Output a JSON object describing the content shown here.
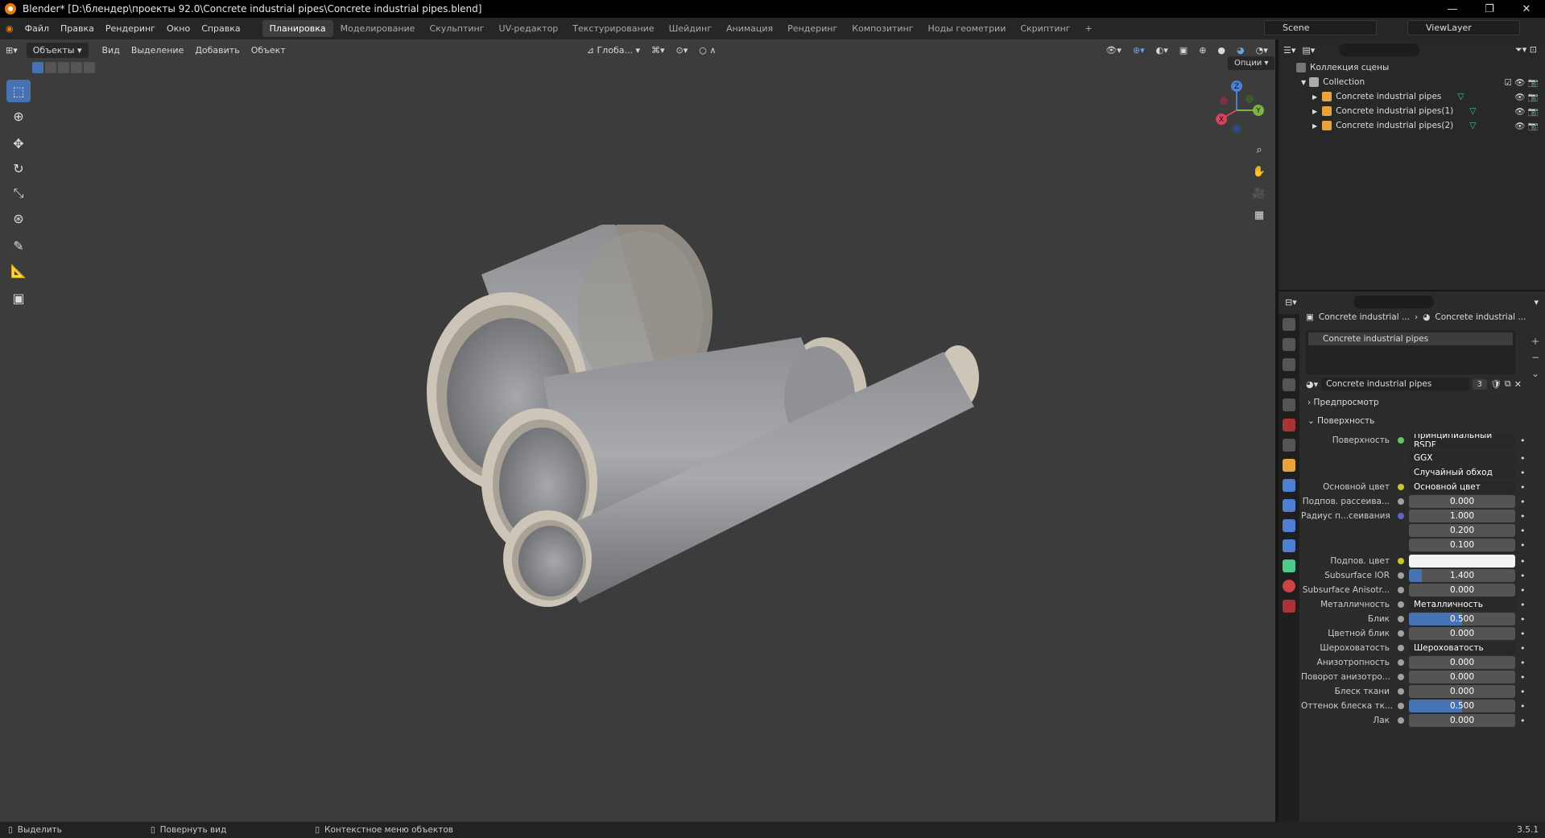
{
  "window": {
    "title": "Blender* [D:\\блендер\\проекты 92.0\\Concrete industrial pipes\\Concrete industrial pipes.blend]",
    "minimize": "—",
    "maximize": "❐",
    "close": "✕"
  },
  "menu": [
    "Файл",
    "Правка",
    "Рендеринг",
    "Окно",
    "Справка"
  ],
  "workspaces": [
    "Планировка",
    "Моделирование",
    "Скульптинг",
    "UV-редактор",
    "Текстурирование",
    "Шейдинг",
    "Анимация",
    "Рендеринг",
    "Композитинг",
    "Ноды геометрии",
    "Скриптинг"
  ],
  "workspace_add": "+",
  "scene": "Scene",
  "view_layer": "ViewLayer",
  "viewport_header": {
    "mode": "Объекты",
    "menus": [
      "Вид",
      "Выделение",
      "Добавить",
      "Объект"
    ],
    "orientation": "Глоба...",
    "options": "Опции"
  },
  "gizmo": {
    "x": "X",
    "y": "Y",
    "z": "Z"
  },
  "outliner": {
    "scene_collection": "Коллекция сцены",
    "collection": "Collection",
    "objects": [
      "Concrete industrial pipes",
      "Concrete industrial pipes(1)",
      "Concrete industrial pipes(2)"
    ]
  },
  "properties": {
    "breadcrumb_object": "Concrete industrial ...",
    "breadcrumb_material": "Concrete industrial ...",
    "slot": "Concrete industrial pipes",
    "material_name": "Concrete industrial pipes",
    "users": "3",
    "sections": {
      "preview": "Предпросмотр",
      "surface": "Поверхность"
    },
    "rows": [
      {
        "label": "Поверхность",
        "value": "Принципиальный BSDF",
        "type": "link",
        "dot": "#63c763"
      },
      {
        "label": "",
        "value": "GGX",
        "type": "enum"
      },
      {
        "label": "",
        "value": "Случайный обход",
        "type": "enum"
      },
      {
        "label": "Основной цвет",
        "value": "Основной цвет",
        "type": "link",
        "dot": "#c7c729"
      },
      {
        "label": "Подпов. рассеива...",
        "value": "0.000",
        "type": "num",
        "dot": "#a1a1a1",
        "fill": 0
      },
      {
        "label": "Радиус п...сеивания",
        "value": "1.000",
        "type": "num",
        "dot": "#6363c7",
        "fill": 0
      },
      {
        "label": "",
        "value": "0.200",
        "type": "num",
        "fill": 0
      },
      {
        "label": "",
        "value": "0.100",
        "type": "num",
        "fill": 0
      },
      {
        "label": "Подпов. цвет",
        "value": "",
        "type": "color",
        "dot": "#c7c729",
        "color": "#f2f2f2"
      },
      {
        "label": "Subsurface IOR",
        "value": "1.400",
        "type": "num",
        "dot": "#a1a1a1",
        "fill": 0.12
      },
      {
        "label": "Subsurface Anisotr...",
        "value": "0.000",
        "type": "num",
        "dot": "#a1a1a1",
        "fill": 0
      },
      {
        "label": "Металличность",
        "value": "Металличность",
        "type": "link",
        "dot": "#a1a1a1"
      },
      {
        "label": "Блик",
        "value": "0.500",
        "type": "num",
        "dot": "#a1a1a1",
        "fill": 0.5
      },
      {
        "label": "Цветной блик",
        "value": "0.000",
        "type": "num",
        "dot": "#a1a1a1",
        "fill": 0
      },
      {
        "label": "Шероховатость",
        "value": "Шероховатость",
        "type": "link",
        "dot": "#a1a1a1"
      },
      {
        "label": "Анизотропность",
        "value": "0.000",
        "type": "num",
        "dot": "#a1a1a1",
        "fill": 0
      },
      {
        "label": "Поворот анизотро...",
        "value": "0.000",
        "type": "num",
        "dot": "#a1a1a1",
        "fill": 0
      },
      {
        "label": "Блеск ткани",
        "value": "0.000",
        "type": "num",
        "dot": "#a1a1a1",
        "fill": 0
      },
      {
        "label": "Оттенок блеска тк...",
        "value": "0.500",
        "type": "num",
        "dot": "#a1a1a1",
        "fill": 0.5
      },
      {
        "label": "Лак",
        "value": "0.000",
        "type": "num",
        "dot": "#a1a1a1",
        "fill": 0
      }
    ]
  },
  "status": {
    "select": "Выделить",
    "rotate": "Повернуть вид",
    "context": "Контекстное меню объектов",
    "version": "3.5.1"
  },
  "colors": {
    "accent": "#4772b3",
    "object_icon": "#e8a33d",
    "mesh_icon": "#4ec98a"
  }
}
